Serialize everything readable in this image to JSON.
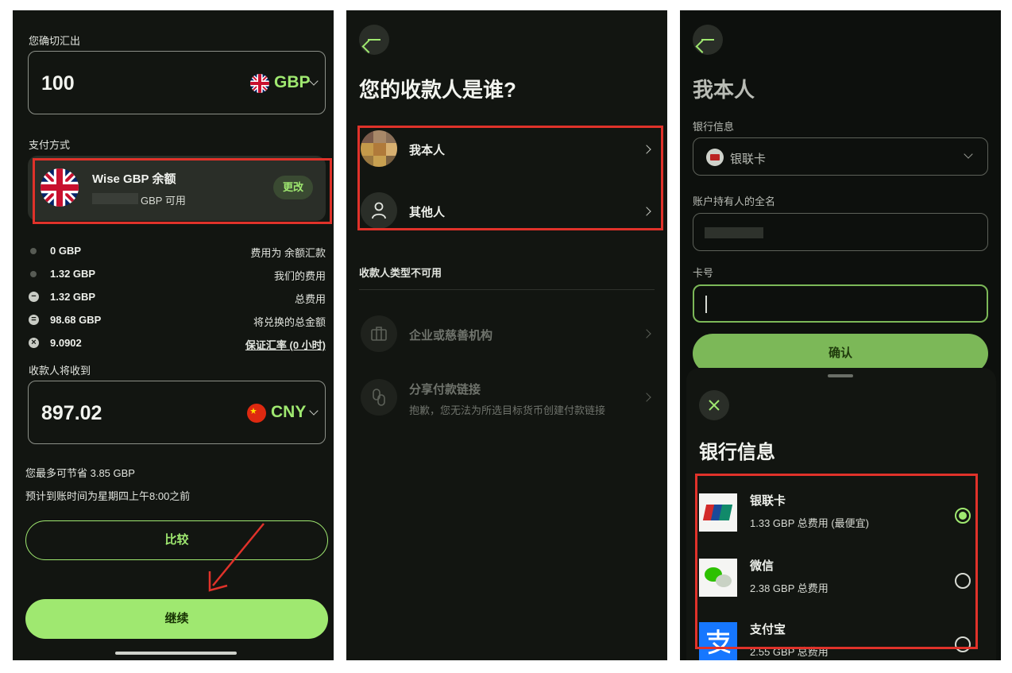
{
  "screen1": {
    "send_label": "您确切汇出",
    "send_amount": "100",
    "send_currency": "GBP",
    "payment_method_label": "支付方式",
    "wise_balance_title": "Wise GBP 余额",
    "available_text": "GBP 可用",
    "change_button": "更改",
    "fees": [
      {
        "amount": "0 GBP",
        "label": "费用为 余额汇款"
      },
      {
        "amount": "1.32 GBP",
        "label": "我们的费用"
      },
      {
        "amount": "1.32 GBP",
        "label": "总费用"
      },
      {
        "amount": "98.68 GBP",
        "label": "将兑换的总金额"
      },
      {
        "amount": "9.0902",
        "label": "保证汇率 (0 小时)"
      }
    ],
    "recipient_gets_label": "收款人将收到",
    "receive_amount": "897.02",
    "receive_currency": "CNY",
    "savings_text": "您最多可节省 3.85 GBP",
    "arrival_text": "预计到账时间为星期四上午8:00之前",
    "compare_button": "比较",
    "continue_button": "继续"
  },
  "screen2": {
    "title": "您的收款人是谁?",
    "options": [
      {
        "label": "我本人"
      },
      {
        "label": "其他人"
      }
    ],
    "unavailable_header": "收款人类型不可用",
    "unavailable": [
      {
        "label": "企业或慈善机构",
        "sub": ""
      },
      {
        "label": "分享付款链接",
        "sub": "抱歉，您无法为所选目标货币创建付款链接"
      }
    ]
  },
  "screen3": {
    "title": "我本人",
    "bank_info_label": "银行信息",
    "bank_selected": "银联卡",
    "holder_label": "账户持有人的全名",
    "card_label": "卡号",
    "confirm_button": "确认",
    "sheet": {
      "title": "银行信息",
      "options": [
        {
          "name": "银联卡",
          "fee": "1.33 GBP 总费用 (最便宜)",
          "selected": true
        },
        {
          "name": "微信",
          "fee": "2.38 GBP 总费用",
          "selected": false
        },
        {
          "name": "支付宝",
          "fee": "2.55 GBP 总费用",
          "selected": false
        }
      ]
    }
  },
  "colors": {
    "accent": "#9fe870",
    "background": "#121511",
    "highlight": "#e0322a"
  }
}
